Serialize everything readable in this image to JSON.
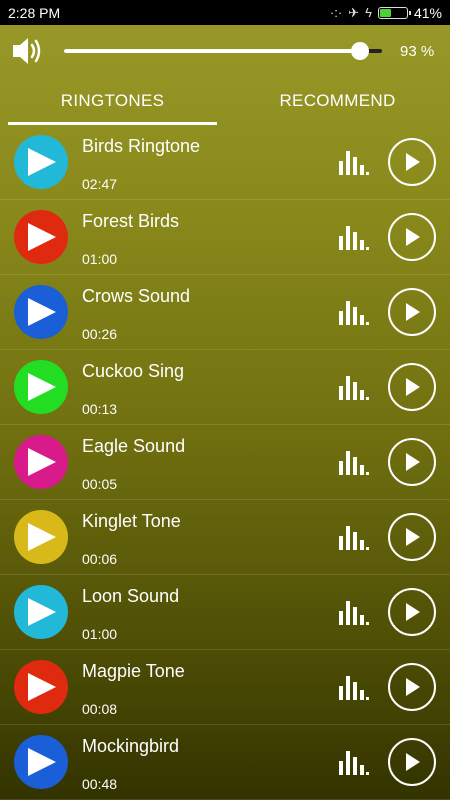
{
  "status_bar": {
    "time": "2:28 PM",
    "battery_text": "41%",
    "battery_level": 0.41
  },
  "volume": {
    "percent_label": "93 %",
    "level": 0.93
  },
  "tabs": [
    {
      "label": "RINGTONES",
      "active": true
    },
    {
      "label": "RECOMMEND",
      "active": false
    }
  ],
  "ringtones": [
    {
      "title": "Birds Ringtone",
      "duration": "02:47",
      "color": "#22b8d8"
    },
    {
      "title": "Forest Birds",
      "duration": "01:00",
      "color": "#e02a10"
    },
    {
      "title": "Crows Sound",
      "duration": "00:26",
      "color": "#1a5ed8"
    },
    {
      "title": "Cuckoo Sing",
      "duration": "00:13",
      "color": "#22dd22"
    },
    {
      "title": "Eagle Sound",
      "duration": "00:05",
      "color": "#d91a8a"
    },
    {
      "title": "Kinglet Tone",
      "duration": "00:06",
      "color": "#d9b81a"
    },
    {
      "title": "Loon Sound",
      "duration": "01:00",
      "color": "#22b8d8"
    },
    {
      "title": "Magpie Tone",
      "duration": "00:08",
      "color": "#e02a10"
    },
    {
      "title": "Mockingbird",
      "duration": "00:48",
      "color": "#1a5ed8"
    }
  ]
}
